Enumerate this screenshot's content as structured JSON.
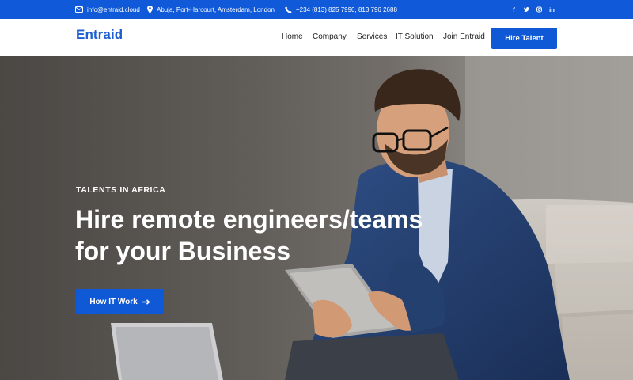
{
  "topbar": {
    "email": "info@entraid.cloud",
    "locations": "Abuja, Port-Harcourt, Amsterdam, London",
    "phone": "+234 (813) 825 7990, 813 796 2688",
    "social": [
      {
        "icon": "facebook-icon",
        "glyph": "f"
      },
      {
        "icon": "twitter-icon",
        "glyph": "t"
      },
      {
        "icon": "instagram-icon",
        "glyph": "◎"
      },
      {
        "icon": "linkedin-icon",
        "glyph": "in"
      }
    ]
  },
  "nav": {
    "logo": "Entraid",
    "links": [
      "Home",
      "Company",
      "Services",
      "IT Solution",
      "Join Entraid"
    ],
    "hire_label": "Hire Talent"
  },
  "hero": {
    "eyebrow": "TALENTS IN AFRICA",
    "headline_line1": "Hire remote engineers/teams",
    "headline_line2": "for your Business",
    "cta_label": "How IT Work"
  },
  "colors": {
    "brand_blue": "#1059d8",
    "logo_blue": "#1b5fd1",
    "text_dark": "#222222",
    "white": "#ffffff"
  }
}
